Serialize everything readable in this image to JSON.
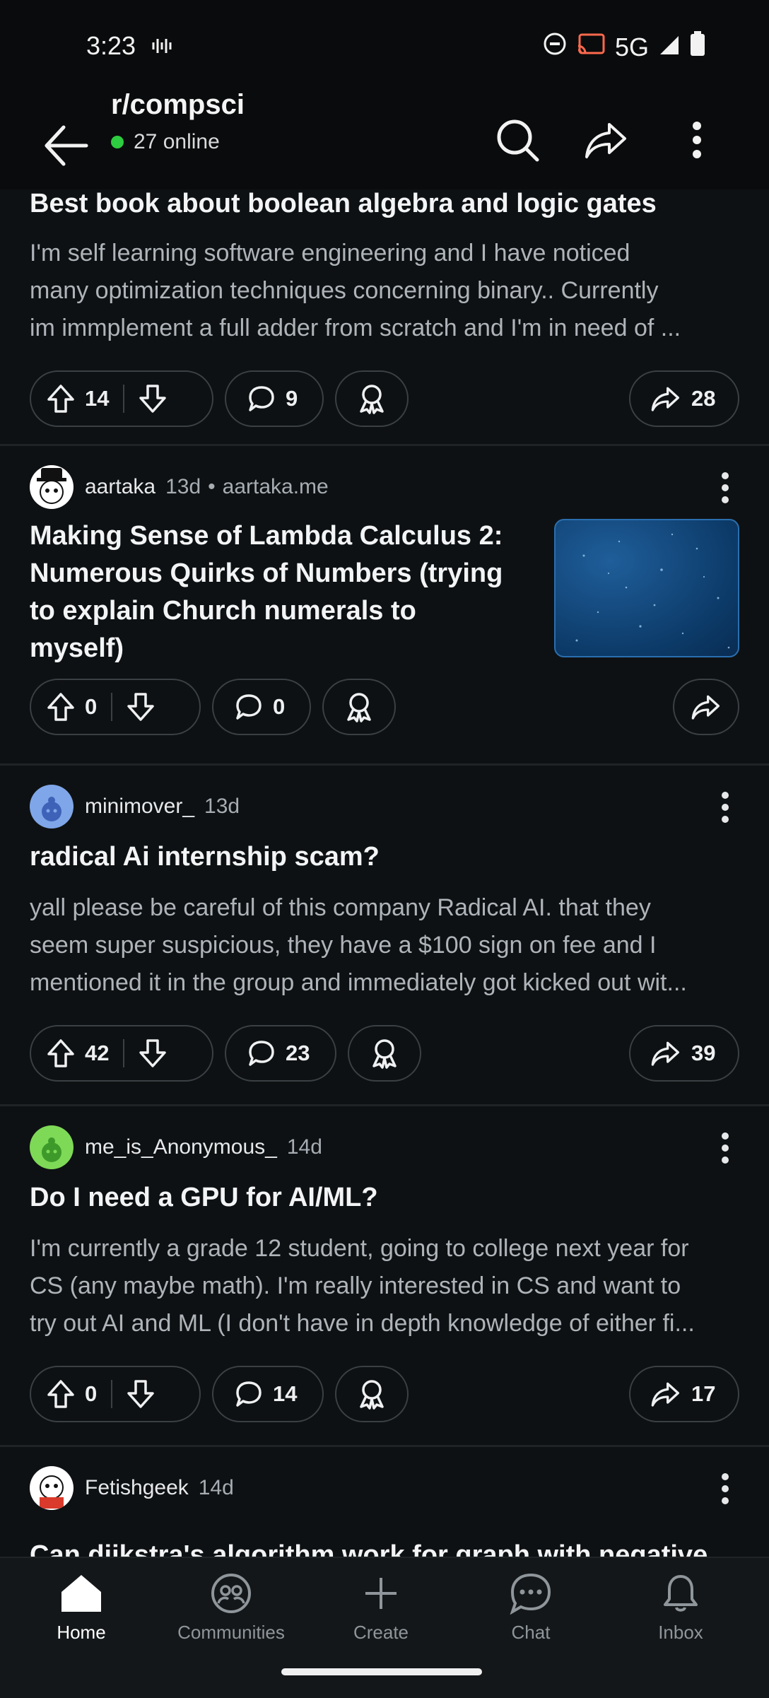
{
  "status_bar": {
    "time": "3:23",
    "network": "5G"
  },
  "header": {
    "subreddit": "r/compsci",
    "online": "27 online"
  },
  "action_labels": {
    "award": "award-icon",
    "share": "share-icon"
  },
  "posts": [
    {
      "author": "",
      "age": "",
      "domain": "",
      "title_lines": [
        "Best book about boolean algebra and logic gates"
      ],
      "body_lines": [
        "I'm self learning software engineering and I have noticed",
        "many optimization techniques concerning binary.. Currently",
        "im immplement a full adder from scratch and I'm in need of ..."
      ],
      "upvotes": "14",
      "comments": "9",
      "shares": "28"
    },
    {
      "author": "aartaka",
      "age": "13d",
      "domain": "aartaka.me",
      "title_lines": [
        "Making Sense of Lambda Calculus 2:",
        "Numerous Quirks of Numbers (trying",
        "to explain Church numerals to",
        "myself)"
      ],
      "body_lines": [],
      "upvotes": "0",
      "comments": "0",
      "shares": ""
    },
    {
      "author": "minimover_",
      "age": "13d",
      "domain": "",
      "title_lines": [
        "radical Ai internship scam?"
      ],
      "body_lines": [
        "yall please be careful of this company Radical AI. that they",
        "seem super suspicious, they have a $100 sign on fee and I",
        "mentioned it in the group and immediately got kicked out wit..."
      ],
      "upvotes": "42",
      "comments": "23",
      "shares": "39"
    },
    {
      "author": "me_is_Anonymous_",
      "age": "14d",
      "domain": "",
      "title_lines": [
        "Do I need a GPU for AI/ML?"
      ],
      "body_lines": [
        "I'm currently a grade 12 student, going to college next year for",
        "CS (any maybe math). I'm really interested in CS and want to",
        "try out AI and ML (I don't have in depth knowledge of either fi..."
      ],
      "upvotes": "0",
      "comments": "14",
      "shares": "17"
    },
    {
      "author": "Fetishgeek",
      "age": "14d",
      "domain": "",
      "title_lines": [
        "Can dijkstra's algorithm work for graph with negative"
      ],
      "body_lines": [],
      "upvotes": "",
      "comments": "",
      "shares": ""
    }
  ],
  "nav": {
    "home": "Home",
    "communities": "Communities",
    "create": "Create",
    "chat": "Chat",
    "inbox": "Inbox"
  },
  "colors": {
    "background": "#0e1113",
    "online_dot": "#2ecc40",
    "thumbnail": "#0c3a68"
  }
}
